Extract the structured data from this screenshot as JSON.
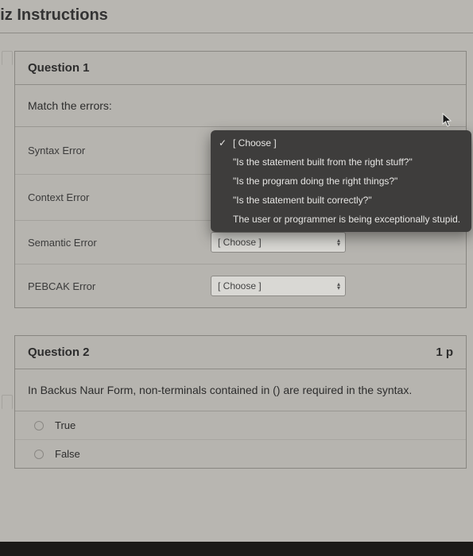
{
  "page_title": "uiz Instructions",
  "q1": {
    "header": "Question 1",
    "prompt": "Match the errors:",
    "rows": [
      {
        "label": "Syntax Error"
      },
      {
        "label": "Context Error"
      },
      {
        "label": "Semantic Error",
        "select": "[ Choose ]"
      },
      {
        "label": "PEBCAK Error",
        "select": "[ Choose ]"
      }
    ],
    "dropdown": {
      "items": [
        "[ Choose ]",
        "\"Is the statement built from the right stuff?\"",
        "\"Is the program doing the right things?\"",
        "\"Is the statement built correctly?\"",
        "The user or programmer is being exceptionally stupid."
      ]
    }
  },
  "q2": {
    "header": "Question 2",
    "points": "1 p",
    "prompt": "In Backus Naur Form, non-terminals contained in () are required in the syntax.",
    "options": [
      "True",
      "False"
    ]
  }
}
